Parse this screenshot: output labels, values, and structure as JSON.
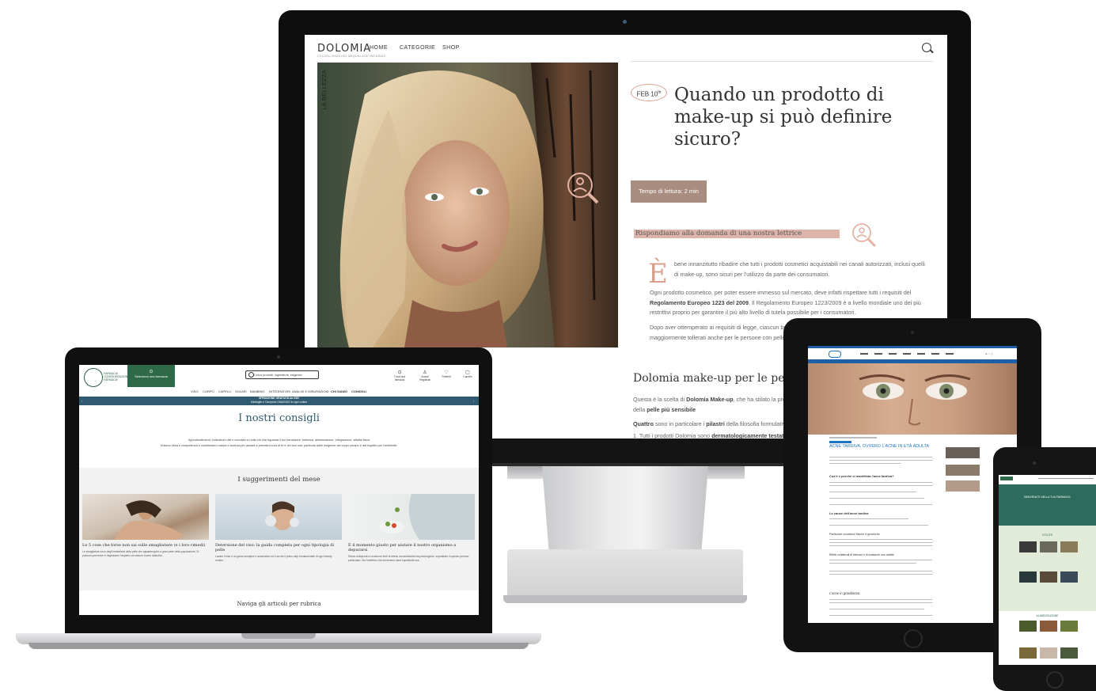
{
  "monitor": {
    "logo": "DOLOMIA",
    "logo_sub": "L'ECCELLENZA DEL MAQUILLAGE NATURALE",
    "nav": [
      "HOME",
      "CATEGORIE",
      "SHOP"
    ],
    "vertical_label": "LA BELLEZZA",
    "date": "FEB 10",
    "date_sup": "th",
    "title": "Quando un prodotto di make-up si può definire sicuro?",
    "reading_time": "Tempo di lettura: 2 min",
    "question": "Rispondiamo alla domanda di una nostra lettrice",
    "dropcap": "È",
    "para1": "bene innanzitutto ribadire che tutti i prodotti cosmetici acquistabili nei canali autorizzati, inclusi quelli di make-up, sono sicuri per l'utilizzo da parte dei consumatori.",
    "para2a": "Ogni prodotto cosmetico, per poter essere immesso sul mercato, deve infatti rispettare tutti i requisiti del",
    "para2b": "Regolamento Europeo 1223 del 2009",
    "para2c": ". Il Regolamento Europeo 1223/2009 è a livello mondiale uno dei più restrittivi proprio per garantire il più alto livello di tutela possibile per i consumatori.",
    "para3": "Dopo aver ottemperato ai requisiti di legge, ciascun brand può poi scegliere di rendere i propri cosmetici maggiormente tollerati anche per le persone con pelle sensibile.",
    "h2": "Dolomia make-up per le pelli sensibili",
    "para4a": "Questa è la scelta di ",
    "para4b": "Dolomia Make-up",
    "para4c": ", che ha stilato la propria formulazione per rispondere alle esigenze anche della ",
    "para4d": "pelle più sensibile",
    "para5a": "Quattro",
    "para5b": " sono in particolare i ",
    "para5c": "pilastri",
    "para5d": " della filosofia formulativa:",
    "para6a": "1. Tutti i prodotti Dolomia sono ",
    "para6b": "dermatologicamente testati"
  },
  "laptop": {
    "logo_text": "FARMACIA CONFEDERAZIONE FARMACIE",
    "select_pharmacy": "Seleziona una farmacia",
    "search_placeholder": "Cerca prodotti, ingredienti, esigenze",
    "icons": [
      "Trova una farmacia",
      "Accedi Registrati",
      "Preferiti",
      "Carrello"
    ],
    "menu": [
      "VISO",
      "CORPO",
      "CAPELLI",
      "SOLARI",
      "BAMBINO",
      "INTEGRATORI",
      "ANALISI E MISURAZIONI",
      "CHI SIAMO",
      "CONSIGLI"
    ],
    "band_line1": "SPEDIZIONE GRATUITA da €30!",
    "band_line2": "Minitaglie e Campioni OMAGGIO in ogni ordine",
    "page_title": "I nostri consigli",
    "intro1": "Approfondimenti, indicazioni utili e curiosità su tutto ciò che riguarda il tuo benessere: bellezza, alimentazione, integrazione, attività fisica",
    "intro2": "Uniamo etica e competenza e combiniamo natura e scienza per aiutarti a prenderti cura di te e dei tuoi cari, partendo dalle esigenze del corpo umano e dal rispetto per l'ambiente.",
    "subtitle": "I suggerimenti del mese",
    "cards": [
      {
        "title": "Le 5 cose che forse non sai sulle smagliature (e i loro rimedi)",
        "text": "Le smagliature sono degli inestetismi della pelle che appartengono a gran parte della popolazione. Si possono prevenire e migliorarne l'aspetto con alcune buone abitudini..."
      },
      {
        "title": "Detersione del viso: la guida completa per ogni tipologia di pelle",
        "text": "Lavare il viso è un gesto semplice e automatico ed è anche il primo step fondamentale di ogni beauty routine..."
      },
      {
        "title": "È il momento giusto per aiutare il nostro organismo a depurarsi",
        "text": "Siamo sottoposti a numerose fonti di stress ma ambientali sia psicologiche, soprattutto in questo periodo particolare. Ma l'obiettivo che dovremmo darci soprattutto ora..."
      }
    ],
    "browse": "Naviga gli articoli per rubrica"
  },
  "tablet": {
    "title": "ACNE TARDIVA, OVVERO L'ACNE IN ETÀ ADULTA",
    "sections": [
      "Cos'è e perché si manifesta l'acne tardiva?",
      "Le cause dell'acne tardiva",
      "Particolari condizioni fisiche e genetiche",
      "Effetti collaterali di farmaci e di sostanze non adatte",
      "L'acne in gravidanza"
    ]
  },
  "phone": {
    "hero_text": "BENVENUTI NELLA TUA FARMACIA",
    "section1": "UTILITÀ",
    "section2": "ALIMENTAZIONE"
  },
  "colors": {
    "dolomia_accent": "#d8a08c",
    "dolomia_button": "#a88d80",
    "farmacia_green": "#2f6a48",
    "farmacia_band": "#2f5a70",
    "tablet_blue": "#1f73c4"
  }
}
